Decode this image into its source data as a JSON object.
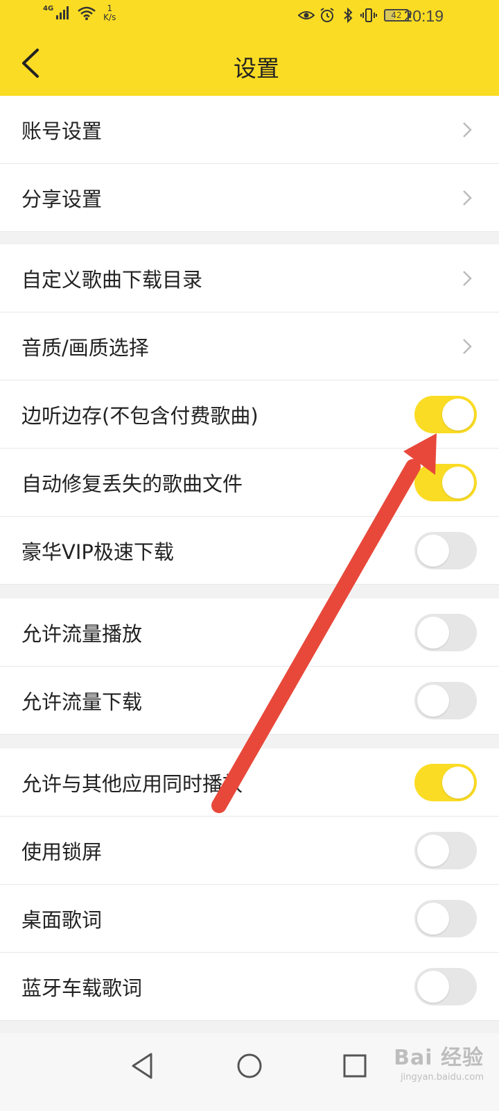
{
  "status_bar": {
    "network": "4G",
    "speed_value": "1",
    "speed_unit": "K/s",
    "battery": "42",
    "time": "20:19",
    "icons": [
      "eye-icon",
      "alarm-icon",
      "bluetooth-icon",
      "vibrate-icon"
    ]
  },
  "header": {
    "title": "设置",
    "back_icon": "chevron-left-icon"
  },
  "colors": {
    "accent": "#fbdc24",
    "toggle_off": "#e6e6e6",
    "arrow": "#e8483a"
  },
  "group1": [
    {
      "label": "账号设置",
      "type": "link"
    },
    {
      "label": "分享设置",
      "type": "link"
    }
  ],
  "group2": [
    {
      "label": "自定义歌曲下载目录",
      "type": "link"
    },
    {
      "label": "音质/画质选择",
      "type": "link"
    },
    {
      "label": "边听边存(不包含付费歌曲)",
      "type": "toggle",
      "on": true
    },
    {
      "label": "自动修复丢失的歌曲文件",
      "type": "toggle",
      "on": true
    },
    {
      "label": "豪华VIP极速下载",
      "type": "toggle",
      "on": false
    }
  ],
  "group3": [
    {
      "label": "允许流量播放",
      "type": "toggle",
      "on": false
    },
    {
      "label": "允许流量下载",
      "type": "toggle",
      "on": false
    }
  ],
  "group4": [
    {
      "label": "允许与其他应用同时播放",
      "type": "toggle",
      "on": true
    },
    {
      "label": "使用锁屏",
      "type": "toggle",
      "on": false
    },
    {
      "label": "桌面歌词",
      "type": "toggle",
      "on": false
    },
    {
      "label": "蓝牙车载歌词",
      "type": "toggle",
      "on": false
    }
  ],
  "navbar": {
    "icons": [
      "back-triangle-icon",
      "home-circle-icon",
      "recents-square-icon"
    ]
  },
  "watermark": {
    "main": "Bai 经验",
    "sub": "jingyan.baidu.com"
  }
}
